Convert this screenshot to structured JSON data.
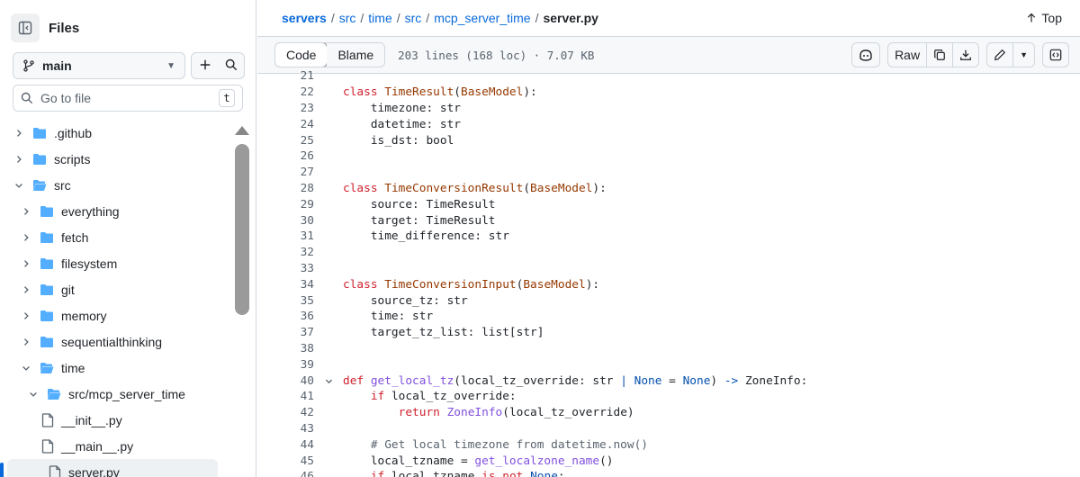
{
  "sidebar": {
    "title": "Files",
    "branch": "main",
    "goto_placeholder": "Go to file",
    "goto_shortcut": "t",
    "tree": [
      {
        "label": ".github",
        "type": "folder",
        "expanded": false,
        "depth": 0
      },
      {
        "label": "scripts",
        "type": "folder",
        "expanded": false,
        "depth": 0
      },
      {
        "label": "src",
        "type": "folder",
        "expanded": true,
        "depth": 0
      },
      {
        "label": "everything",
        "type": "folder",
        "expanded": false,
        "depth": 1
      },
      {
        "label": "fetch",
        "type": "folder",
        "expanded": false,
        "depth": 1
      },
      {
        "label": "filesystem",
        "type": "folder",
        "expanded": false,
        "depth": 1
      },
      {
        "label": "git",
        "type": "folder",
        "expanded": false,
        "depth": 1
      },
      {
        "label": "memory",
        "type": "folder",
        "expanded": false,
        "depth": 1
      },
      {
        "label": "sequentialthinking",
        "type": "folder",
        "expanded": false,
        "depth": 1
      },
      {
        "label": "time",
        "type": "folder",
        "expanded": true,
        "depth": 1
      },
      {
        "label": "src/mcp_server_time",
        "type": "folder",
        "expanded": true,
        "depth": 2
      },
      {
        "label": "__init__.py",
        "type": "file",
        "depth": 3
      },
      {
        "label": "__main__.py",
        "type": "file",
        "depth": 3
      },
      {
        "label": "server.py",
        "type": "file",
        "depth": 3,
        "selected": true
      }
    ]
  },
  "breadcrumb": {
    "parts": [
      "servers",
      "src",
      "time",
      "src",
      "mcp_server_time"
    ],
    "current": "server.py",
    "top_label": "Top"
  },
  "file_header": {
    "tab_code": "Code",
    "tab_blame": "Blame",
    "meta": "203 lines (168 loc) · 7.07 KB",
    "raw_label": "Raw"
  },
  "code": {
    "lines": [
      {
        "n": "21",
        "tokens": []
      },
      {
        "n": "22",
        "tokens": [
          [
            "kw",
            "class "
          ],
          [
            "cls",
            "TimeResult"
          ],
          [
            "src",
            "("
          ],
          [
            "cls",
            "BaseModel"
          ],
          [
            "src",
            "):"
          ]
        ]
      },
      {
        "n": "23",
        "tokens": [
          [
            "src",
            "    timezone: str"
          ]
        ]
      },
      {
        "n": "24",
        "tokens": [
          [
            "src",
            "    datetime: str"
          ]
        ]
      },
      {
        "n": "25",
        "tokens": [
          [
            "src",
            "    is_dst: bool"
          ]
        ]
      },
      {
        "n": "26",
        "tokens": []
      },
      {
        "n": "27",
        "tokens": []
      },
      {
        "n": "28",
        "tokens": [
          [
            "kw",
            "class "
          ],
          [
            "cls",
            "TimeConversionResult"
          ],
          [
            "src",
            "("
          ],
          [
            "cls",
            "BaseModel"
          ],
          [
            "src",
            "):"
          ]
        ]
      },
      {
        "n": "29",
        "tokens": [
          [
            "src",
            "    source: TimeResult"
          ]
        ]
      },
      {
        "n": "30",
        "tokens": [
          [
            "src",
            "    target: TimeResult"
          ]
        ]
      },
      {
        "n": "31",
        "tokens": [
          [
            "src",
            "    time_difference: str"
          ]
        ]
      },
      {
        "n": "32",
        "tokens": []
      },
      {
        "n": "33",
        "tokens": []
      },
      {
        "n": "34",
        "tokens": [
          [
            "kw",
            "class "
          ],
          [
            "cls",
            "TimeConversionInput"
          ],
          [
            "src",
            "("
          ],
          [
            "cls",
            "BaseModel"
          ],
          [
            "src",
            "):"
          ]
        ]
      },
      {
        "n": "35",
        "tokens": [
          [
            "src",
            "    source_tz: str"
          ]
        ]
      },
      {
        "n": "36",
        "tokens": [
          [
            "src",
            "    time: str"
          ]
        ]
      },
      {
        "n": "37",
        "tokens": [
          [
            "src",
            "    target_tz_list: list[str]"
          ]
        ]
      },
      {
        "n": "38",
        "tokens": []
      },
      {
        "n": "39",
        "tokens": []
      },
      {
        "n": "40",
        "fold": true,
        "tokens": [
          [
            "kw",
            "def "
          ],
          [
            "fn",
            "get_local_tz"
          ],
          [
            "src",
            "(local_tz_override: str "
          ],
          [
            "op",
            "|"
          ],
          [
            "src",
            " "
          ],
          [
            "bl",
            "None"
          ],
          [
            "src",
            " = "
          ],
          [
            "bl",
            "None"
          ],
          [
            "src",
            ") "
          ],
          [
            "op",
            "->"
          ],
          [
            "src",
            " ZoneInfo:"
          ]
        ]
      },
      {
        "n": "41",
        "tokens": [
          [
            "src",
            "    "
          ],
          [
            "kw",
            "if"
          ],
          [
            "src",
            " local_tz_override:"
          ]
        ]
      },
      {
        "n": "42",
        "tokens": [
          [
            "src",
            "        "
          ],
          [
            "kw",
            "return"
          ],
          [
            "src",
            " "
          ],
          [
            "fn",
            "ZoneInfo"
          ],
          [
            "src",
            "(local_tz_override)"
          ]
        ]
      },
      {
        "n": "43",
        "tokens": []
      },
      {
        "n": "44",
        "tokens": [
          [
            "cm",
            "    # Get local timezone from datetime.now()"
          ]
        ]
      },
      {
        "n": "45",
        "tokens": [
          [
            "src",
            "    local_tzname = "
          ],
          [
            "fn",
            "get_localzone_name"
          ],
          [
            "src",
            "()"
          ]
        ]
      },
      {
        "n": "46",
        "tokens": [
          [
            "src",
            "    "
          ],
          [
            "kw",
            "if"
          ],
          [
            "src",
            " local_tzname "
          ],
          [
            "kw",
            "is not"
          ],
          [
            "src",
            " "
          ],
          [
            "bl",
            "None"
          ],
          [
            "src",
            ":"
          ]
        ]
      }
    ]
  },
  "colors": {
    "link": "#0969da",
    "keyword": "#cf222e",
    "class_name": "#953800",
    "function": "#8250df",
    "folder": "#54aeff"
  }
}
